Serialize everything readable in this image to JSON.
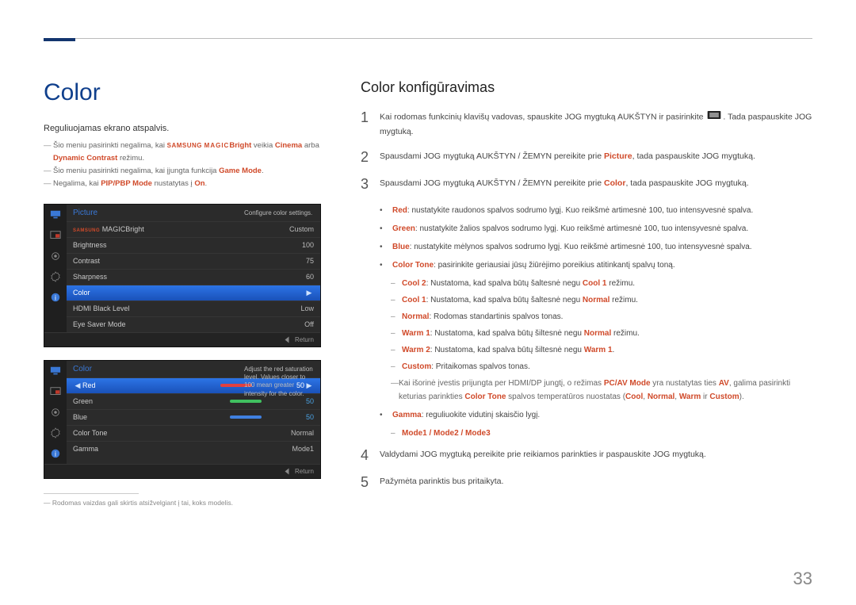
{
  "page_number": "33",
  "left": {
    "heading": "Color",
    "intro": "Reguliuojamas ekrano atspalvis.",
    "notes": {
      "n1_pre": "Šio meniu pasirinkti negalima, kai ",
      "n1_samsung": "SAMSUNG",
      "n1_magic": "MAGIC",
      "n1_bright": "Bright",
      "n1_mid": " veikia ",
      "n1_cinema": "Cinema",
      "n1_or": " arba ",
      "n1_dynamic": "Dynamic Contrast",
      "n1_end": " režimu.",
      "n2_pre": "Šio meniu pasirinkti negalima, kai įjungta funkcija ",
      "n2_game": "Game Mode",
      "n2_end": ".",
      "n3_pre": "Negalima, kai ",
      "n3_pip": "PIP/PBP Mode",
      "n3_mid": " nustatytas į ",
      "n3_on": "On",
      "n3_end": "."
    },
    "osd1": {
      "title": "Picture",
      "help": "Configure color settings.",
      "rows": [
        {
          "label": "MAGICBright",
          "value": "Custom"
        },
        {
          "label": "Brightness",
          "value": "100"
        },
        {
          "label": "Contrast",
          "value": "75"
        },
        {
          "label": "Sharpness",
          "value": "60"
        },
        {
          "label": "Color",
          "value": "",
          "sel": true
        },
        {
          "label": "HDMI Black Level",
          "value": "Low"
        },
        {
          "label": "Eye Saver Mode",
          "value": "Off"
        }
      ],
      "return": "Return"
    },
    "osd2": {
      "title": "Color",
      "help": "Adjust the red saturation level. Values closer to 100 mean greater intensity for the color.",
      "rows": [
        {
          "label": "Red",
          "value": "50",
          "sel": true,
          "bar": "#e04040"
        },
        {
          "label": "Green",
          "value": "50",
          "bar": "#40c060"
        },
        {
          "label": "Blue",
          "value": "50",
          "bar": "#4080e0"
        },
        {
          "label": "Color Tone",
          "value": "Normal"
        },
        {
          "label": "Gamma",
          "value": "Mode1"
        }
      ],
      "return": "Return"
    },
    "footnote": "Rodomas vaizdas gali skirtis atsižvelgiant į tai, koks modelis."
  },
  "right": {
    "heading": "Color konfigūravimas",
    "step1_a": "Kai rodomas funkcinių klavišų vadovas, spauskite JOG mygtuką AUKŠTYN ir pasirinkite ",
    "step1_b": ". Tada paspauskite JOG mygtuką.",
    "step2_a": "Spausdami JOG mygtuką AUKŠTYN / ŽEMYN pereikite prie ",
    "step2_pic": "Picture",
    "step2_b": ", tada paspauskite JOG mygtuką.",
    "step3_a": "Spausdami JOG mygtuką AUKŠTYN / ŽEMYN pereikite prie ",
    "step3_col": "Color",
    "step3_b": ", tada paspauskite JOG mygtuką.",
    "bullets": {
      "red_l": "Red",
      "red_t": ": nustatykite raudonos spalvos sodrumo lygį. Kuo reikšmė artimesnė 100, tuo intensyvesnė spalva.",
      "green_l": "Green",
      "green_t": ": nustatykite žalios spalvos sodrumo lygį. Kuo reikšmė artimesnė 100, tuo intensyvesnė spalva.",
      "blue_l": "Blue",
      "blue_t": ": nustatykite mėlynos spalvos sodrumo lygį. Kuo reikšmė artimesnė 100, tuo intensyvesnė spalva.",
      "ctone_l": "Color Tone",
      "ctone_t": ": pasirinkite geriausiai jūsų žiūrėjimo poreikius atitinkantį spalvų toną.",
      "cool2_l": "Cool 2",
      "cool2_t": ": Nustatoma, kad spalva būtų šaltesnė negu ",
      "cool2_hl": "Cool 1",
      "cool2_end": " režimu.",
      "cool1_l": "Cool 1",
      "cool1_t": ": Nustatoma, kad spalva būtų šaltesnė negu ",
      "cool1_hl": "Normal",
      "cool1_end": " režimu.",
      "normal_l": "Normal",
      "normal_t": ": Rodomas standartinis spalvos tonas.",
      "warm1_l": "Warm 1",
      "warm1_t": ": Nustatoma, kad spalva būtų šiltesnė negu ",
      "warm1_hl": "Normal",
      "warm1_end": " režimu.",
      "warm2_l": "Warm 2",
      "warm2_t": ": Nustatoma, kad spalva būtų šiltesnė negu ",
      "warm2_hl": "Warm 1",
      "warm2_end": ".",
      "custom_l": "Custom",
      "custom_t": ": Pritaikomas spalvos tonas.",
      "pcav_a": "Kai išorinė įvestis prijungta per HDMI/DP jungtį, o režimas ",
      "pcav_l": "PC/AV Mode",
      "pcav_b": " yra nustatytas ties ",
      "pcav_av": "AV",
      "pcav_c": ", galima pasirinkti keturias parinkties ",
      "pcav_ct": "Color Tone",
      "pcav_d": " spalvos temperatūros nuostatas (",
      "pcav_cool": "Cool",
      "pcav_sep1": ", ",
      "pcav_norm": "Normal",
      "pcav_sep2": ", ",
      "pcav_warm": "Warm",
      "pcav_or": " ir ",
      "pcav_cust": "Custom",
      "pcav_end": ").",
      "gamma_l": "Gamma",
      "gamma_t": ": reguliuokite vidutinį skaisčio lygį.",
      "modes": "Mode1 / Mode2 / Mode3"
    },
    "step4": "Valdydami JOG mygtuką pereikite prie reikiamos parinkties ir paspauskite JOG mygtuką.",
    "step5": "Pažymėta parinktis bus pritaikyta."
  }
}
